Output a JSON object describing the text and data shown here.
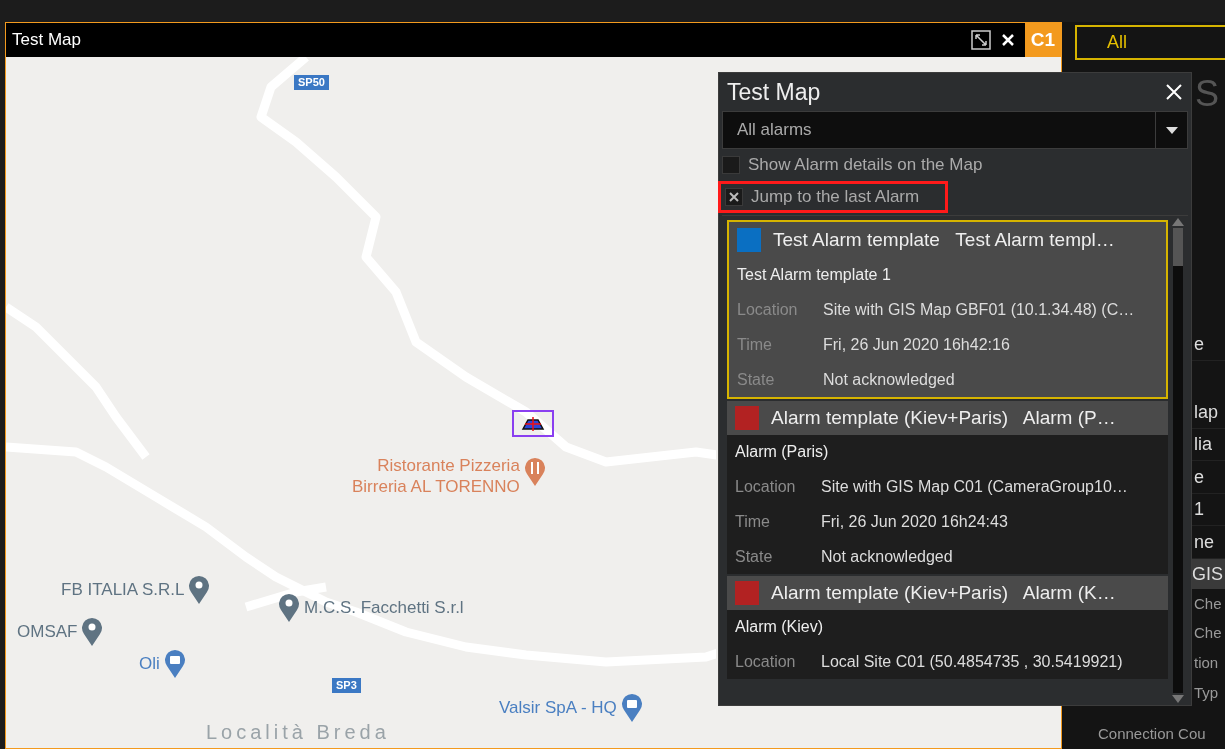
{
  "window": {
    "title": "Test Map",
    "badge": "C1"
  },
  "side_panel": {
    "tab": {
      "label": "All",
      "selected": true
    },
    "fragments": [
      {
        "text": "S",
        "kind": "heading"
      },
      {
        "text": "e",
        "kind": "row"
      },
      {
        "text": "lap",
        "kind": "row"
      },
      {
        "text": "lia",
        "kind": "row"
      },
      {
        "text": "e",
        "kind": "row"
      },
      {
        "text": "1",
        "kind": "row"
      },
      {
        "text": "ne",
        "kind": "row"
      },
      {
        "text": "GIS",
        "kind": "highlight"
      },
      {
        "text": "Che",
        "kind": "small"
      },
      {
        "text": "Che",
        "kind": "small"
      },
      {
        "text": "tion",
        "kind": "small"
      },
      {
        "text": "Typ",
        "kind": "small"
      },
      {
        "text": "Connection Cou",
        "kind": "wide"
      }
    ]
  },
  "map": {
    "labels": [
      {
        "kind": "road",
        "text": "SP50"
      },
      {
        "kind": "restaurant",
        "lines": [
          "Ristorante Pizzeria",
          "Birreria AL TORENNO"
        ],
        "color": "#d9825b"
      },
      {
        "kind": "place",
        "text": "FB ITALIA S.R.L",
        "color": "#5f7382"
      },
      {
        "kind": "place",
        "text": "M.C.S. Facchetti S.r.l",
        "color": "#5f7382"
      },
      {
        "kind": "place",
        "text": "OMSAF",
        "color": "#5f7382"
      },
      {
        "kind": "shop",
        "text": "Oli",
        "color": "#4a7fc1"
      },
      {
        "kind": "road",
        "text": "SP3"
      },
      {
        "kind": "shop",
        "text": "Valsir SpA - HQ",
        "color": "#4a7fc1"
      },
      {
        "kind": "area",
        "text": "Località Breda"
      }
    ]
  },
  "popup": {
    "title": "Test Map",
    "filter": {
      "value": "All alarms"
    },
    "options": [
      {
        "label": "Show Alarm details on the Map",
        "checked": false,
        "highlighted": false
      },
      {
        "label": "Jump to the last Alarm",
        "checked": true,
        "highlighted": true
      }
    ],
    "alarms": [
      {
        "color": "#0a6fc2",
        "selected": true,
        "title": "Test Alarm template   Test Alarm templ…",
        "name": "Test Alarm template 1",
        "fields": [
          {
            "label": "Location",
            "value": "Site with GIS Map GBF01 (10.1.34.48) (C…"
          },
          {
            "label": "Time",
            "value": "Fri, 26 Jun 2020  16h42:16"
          },
          {
            "label": "State",
            "value": "Not acknowledged"
          }
        ]
      },
      {
        "color": "#b22222",
        "selected": false,
        "title": "Alarm template (Kiev+Paris)   Alarm (P…",
        "name": "Alarm (Paris)",
        "fields": [
          {
            "label": "Location",
            "value": "Site with GIS Map C01 (CameraGroup10…"
          },
          {
            "label": "Time",
            "value": "Fri, 26 Jun 2020  16h24:43"
          },
          {
            "label": "State",
            "value": "Not acknowledged"
          }
        ]
      },
      {
        "color": "#b22222",
        "selected": false,
        "title": "Alarm template (Kiev+Paris)   Alarm (K…",
        "name": "Alarm (Kiev)",
        "fields": [
          {
            "label": "Location",
            "value": "Local Site C01 (50.4854735 , 30.5419921)"
          }
        ]
      }
    ]
  }
}
